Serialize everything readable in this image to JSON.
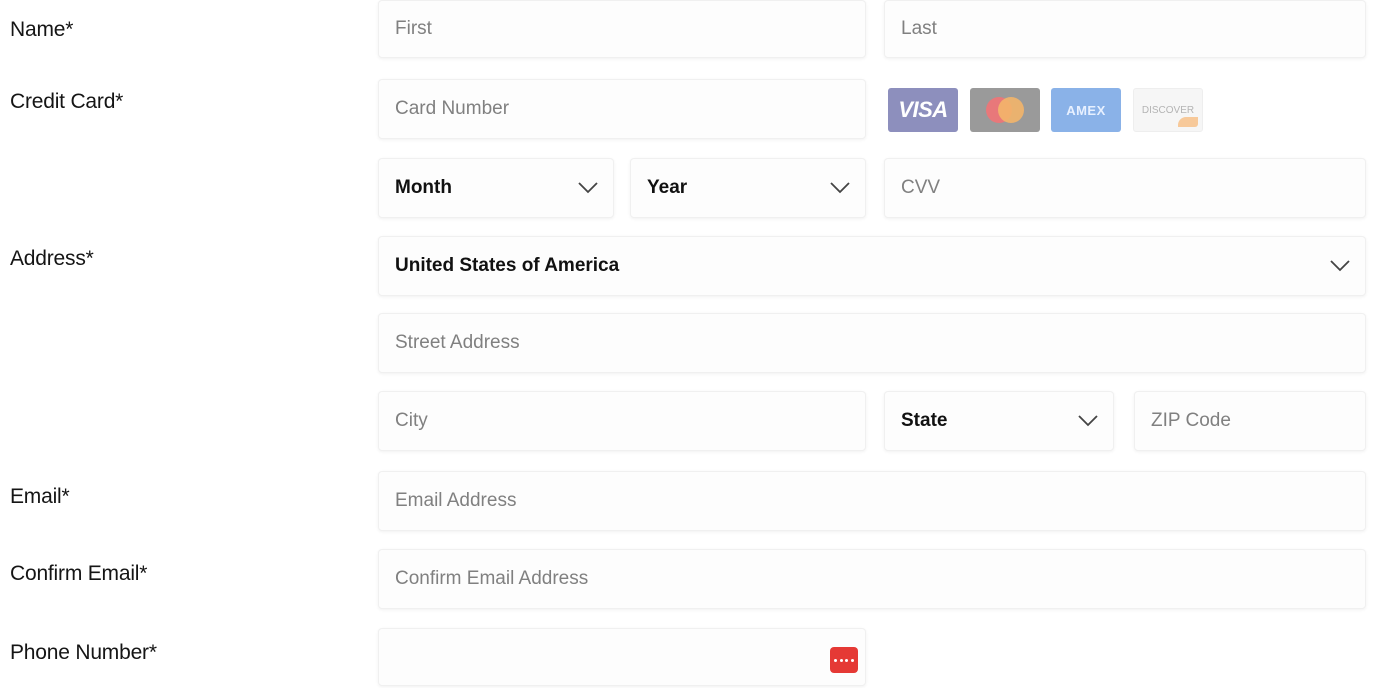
{
  "labels": {
    "name": "Name*",
    "credit_card": "Credit Card*",
    "address": "Address*",
    "email": "Email*",
    "confirm_email": "Confirm Email*",
    "phone": "Phone Number*"
  },
  "name": {
    "first_placeholder": "First",
    "last_placeholder": "Last"
  },
  "card": {
    "number_placeholder": "Card Number",
    "month": "Month",
    "year": "Year",
    "cvv_placeholder": "CVV",
    "brands": {
      "visa": "VISA",
      "amex": "AMEX",
      "discover": "DISCOVER"
    }
  },
  "address": {
    "country": "United States of America",
    "street_placeholder": "Street Address",
    "city_placeholder": "City",
    "state": "State",
    "zip_placeholder": "ZIP Code"
  },
  "email": {
    "placeholder": "Email Address",
    "confirm_placeholder": "Confirm Email Address"
  },
  "phone": {
    "icon": "password-manager-icon"
  },
  "colors": {
    "visa_bg": "#8d8fbd",
    "mastercard_bg": "#9a9a9a",
    "amex_bg": "#8ab2e8",
    "phone_icon_bg": "#e53935"
  }
}
